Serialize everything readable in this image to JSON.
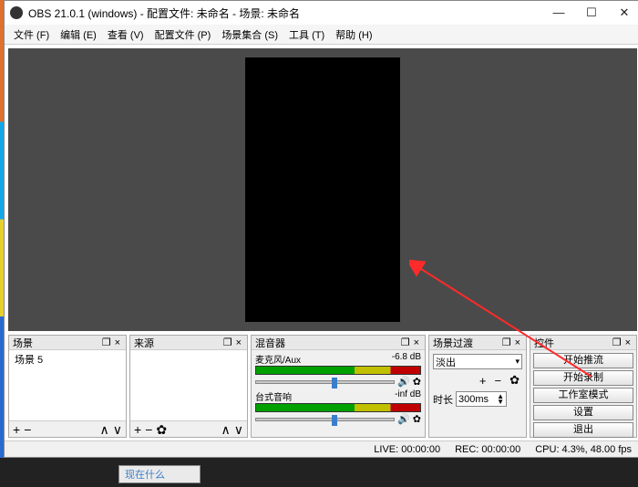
{
  "title": "OBS 21.0.1 (windows) - 配置文件: 未命名 - 场景: 未命名",
  "menus": {
    "file": "文件 (F)",
    "edit": "编辑 (E)",
    "view": "查看 (V)",
    "profile": "配置文件 (P)",
    "scenes": "场景集合 (S)",
    "tools": "工具 (T)",
    "help": "帮助 (H)"
  },
  "panels": {
    "scenes": {
      "title": "场景",
      "items": [
        "场景 5"
      ]
    },
    "sources": {
      "title": "来源"
    },
    "mixer": {
      "title": "混音器",
      "channels": [
        {
          "name": "麦克风/Aux",
          "db": "-6.8 dB",
          "knob": 0.55
        },
        {
          "name": "台式音响",
          "db": "-inf dB",
          "knob": 0.55
        }
      ]
    },
    "transitions": {
      "title": "场景过渡",
      "selected": "淡出",
      "duration_label": "时长",
      "duration_value": "300ms"
    },
    "controls": {
      "title": "控件",
      "buttons": {
        "start_stream": "开始推流",
        "start_record": "开始录制",
        "studio_mode": "工作室模式",
        "settings": "设置",
        "exit": "退出"
      }
    }
  },
  "status": {
    "live": "LIVE: 00:00:00",
    "rec": "REC: 00:00:00",
    "cpu": "CPU: 4.3%, 48.00 fps"
  },
  "taskbar": {
    "item": "现在什么"
  }
}
